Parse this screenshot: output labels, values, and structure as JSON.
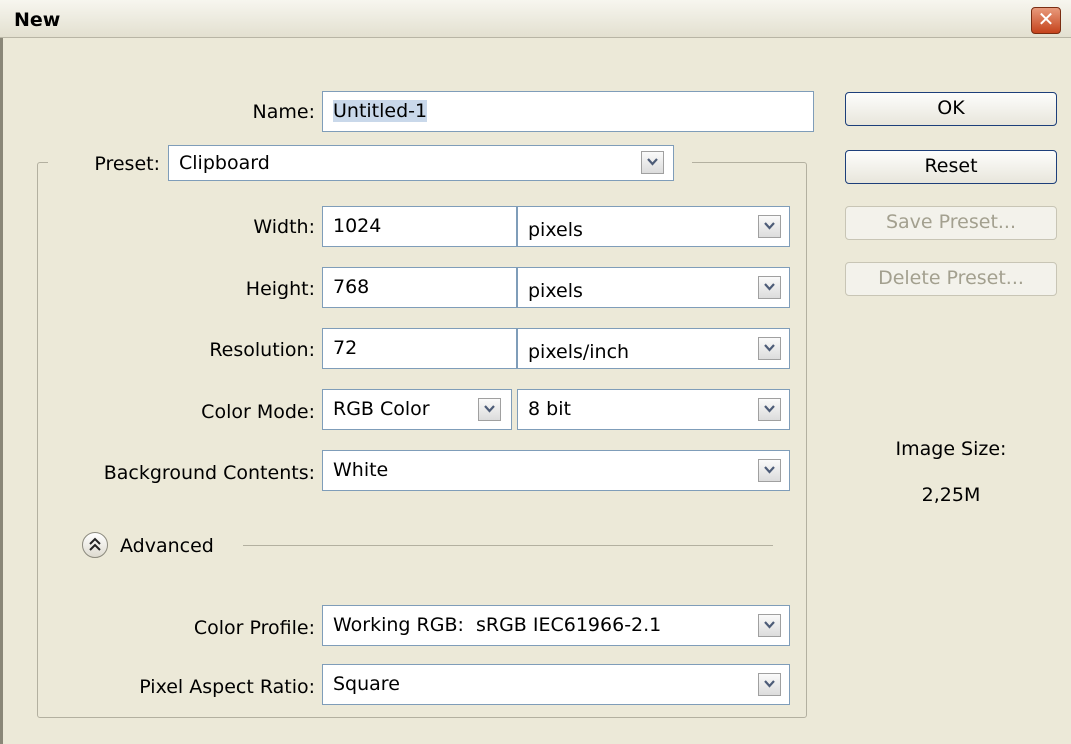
{
  "window": {
    "title": "New",
    "close_glyph": "✕"
  },
  "name": {
    "label": "Name:",
    "value": "Untitled-1"
  },
  "preset": {
    "label": "Preset:",
    "value": "Clipboard"
  },
  "width": {
    "label": "Width:",
    "value": "1024",
    "unit": "pixels"
  },
  "height": {
    "label": "Height:",
    "value": "768",
    "unit": "pixels"
  },
  "resolution": {
    "label": "Resolution:",
    "value": "72",
    "unit": "pixels/inch"
  },
  "color_mode": {
    "label": "Color Mode:",
    "value": "RGB Color",
    "depth": "8 bit"
  },
  "background": {
    "label": "Background Contents:",
    "value": "White"
  },
  "advanced": {
    "label": "Advanced",
    "icon": "double-chevron-up-icon"
  },
  "color_profile": {
    "label": "Color Profile:",
    "value": "Working RGB:  sRGB IEC61966-2.1"
  },
  "pixel_aspect": {
    "label": "Pixel Aspect Ratio:",
    "value": "Square"
  },
  "buttons": {
    "ok": "OK",
    "reset": "Reset",
    "save_preset": "Save Preset...",
    "delete_preset": "Delete Preset..."
  },
  "image_size": {
    "label": "Image Size:",
    "value": "2,25M"
  },
  "colors": {
    "field_border": "#7f9db9",
    "dialog_bg": "#ece9d8",
    "button_border": "#1d3f7a",
    "close_red": "#c5431c"
  }
}
